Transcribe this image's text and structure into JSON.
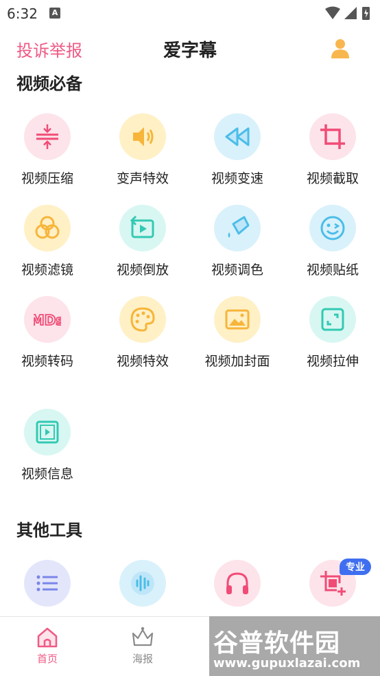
{
  "status_bar": {
    "time": "6:32",
    "notification_badge": "A"
  },
  "header": {
    "report_link": "投诉举报",
    "title": "爱字幕",
    "user_icon": "user-icon"
  },
  "sections": {
    "essentials": {
      "title": "视频必备",
      "items": [
        {
          "label": "视频压缩",
          "icon": "compress-icon"
        },
        {
          "label": "变声特效",
          "icon": "speaker-icon"
        },
        {
          "label": "视频变速",
          "icon": "rewind-icon"
        },
        {
          "label": "视频截取",
          "icon": "crop-icon"
        },
        {
          "label": "视频滤镜",
          "icon": "filter-icon"
        },
        {
          "label": "视频倒放",
          "icon": "reverse-icon"
        },
        {
          "label": "视频调色",
          "icon": "color-icon"
        },
        {
          "label": "视频贴纸",
          "icon": "sticker-icon"
        },
        {
          "label": "视频转码",
          "icon": "transcode-icon",
          "icon_text": "MDs"
        },
        {
          "label": "视频特效",
          "icon": "palette-icon"
        },
        {
          "label": "视频加封面",
          "icon": "cover-icon"
        },
        {
          "label": "视频拉伸",
          "icon": "stretch-icon"
        },
        {
          "label": "视频信息",
          "icon": "info-icon"
        }
      ]
    },
    "other_tools": {
      "title": "其他工具",
      "items": [
        {
          "icon": "list-icon"
        },
        {
          "icon": "audio-wave-icon"
        },
        {
          "icon": "headphones-icon"
        },
        {
          "icon": "crop-add-icon",
          "badge": "专业"
        }
      ]
    }
  },
  "bottom_nav": {
    "items": [
      {
        "label": "首页",
        "icon": "home-icon",
        "active": true
      },
      {
        "label": "海报",
        "icon": "crown-icon",
        "active": false
      }
    ]
  },
  "watermark": {
    "title": "谷普软件园",
    "url": "www.gupuxlazai.com"
  },
  "colors": {
    "accent": "#ee5a86",
    "badge_blue": "#3f6ff0",
    "user_icon": "#f8b74e"
  }
}
